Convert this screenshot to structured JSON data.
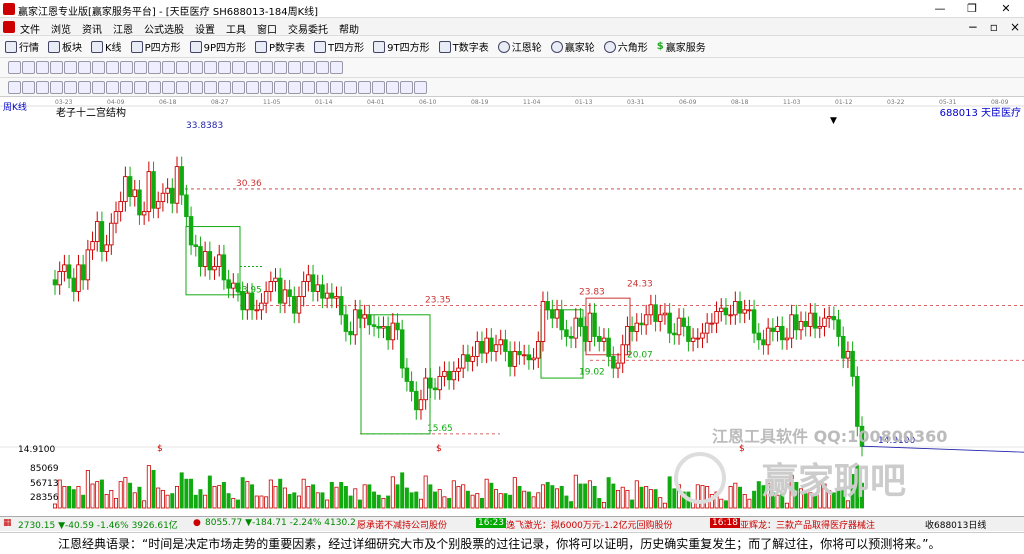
{
  "window": {
    "title": "赢家江恩专业版[赢家服务平台] - [天臣医疗  SH688013-184周K线]"
  },
  "menu": [
    "文件",
    "浏览",
    "资讯",
    "江恩",
    "公式选股",
    "设置",
    "工具",
    "窗口",
    "交易委托",
    "帮助"
  ],
  "toolbar": [
    "行情",
    "板块",
    "K线",
    "P四方形",
    "9P四方形",
    "P数字表",
    "T四方形",
    "9T四方形",
    "T数字表",
    "江恩轮",
    "赢家轮",
    "六角形",
    "赢家服务"
  ],
  "chart": {
    "period": "周K线",
    "indicator": "老子十二宫结构",
    "stock": "688013  天臣医疗",
    "date_ticks": [
      "03-23",
      "04-09",
      "06-18",
      "08-27",
      "11-05",
      "01-14",
      "04-01",
      "06-10",
      "08-19",
      "11-04",
      "01-13",
      "03-31",
      "06-09",
      "08-18",
      "11-03",
      "01-12",
      "03-22",
      "05-31",
      "08-09"
    ],
    "level_labels": [
      "33.8383",
      "30.36",
      "23.95",
      "23.35",
      "19.02",
      "15.65",
      "23.83",
      "24.33",
      "20.07",
      "14.9100"
    ],
    "price_left": "14.9100",
    "vol_labels": [
      "85069",
      "56713",
      "28356"
    ],
    "markers": [
      "$",
      "$",
      "$"
    ],
    "watermark1": "江恩工具软件  QQ:100800360",
    "watermark2": "赢家聊吧"
  },
  "chart_data": {
    "type": "candlestick",
    "x_ticks": [
      "03-23",
      "04-09",
      "06-18",
      "08-27",
      "11-05",
      "01-14",
      "04-01",
      "06-10",
      "08-19",
      "11-04",
      "01-13",
      "03-31",
      "06-09",
      "08-18",
      "11-03",
      "01-12",
      "03-22",
      "05-31",
      "08-09"
    ],
    "close": [
      24.6,
      25.4,
      25.8,
      25.0,
      24.2,
      25.8,
      24.9,
      26.7,
      27.2,
      28.4,
      26.6,
      27.0,
      28.3,
      29.0,
      29.6,
      31.1,
      29.9,
      30.3,
      28.8,
      29.0,
      31.4,
      29.2,
      29.6,
      30.1,
      30.4,
      29.5,
      31.7,
      30.0,
      28.7,
      27.0,
      26.9,
      25.7,
      26.6,
      25.5,
      25.7,
      26.4,
      24.9,
      24.4,
      24.7,
      24.2,
      23.1,
      24.1,
      23.1,
      23.1,
      23.5,
      24.2,
      24.8,
      25.0,
      23.5,
      24.3,
      23.9,
      22.9,
      23.9,
      24.8,
      25.2,
      24.2,
      24.6,
      23.8,
      24.1,
      23.8,
      23.9,
      22.8,
      21.8,
      21.6,
      23.1,
      22.6,
      22.8,
      22.2,
      22.1,
      22.0,
      22.1,
      21.3,
      22.3,
      21.9,
      19.6,
      18.8,
      18.2,
      17.1,
      17.7,
      19.0,
      18.4,
      18.3,
      19.1,
      19.4,
      18.9,
      19.4,
      19.6,
      20.4,
      20.0,
      20.3,
      21.2,
      20.5,
      21.4,
      20.6,
      21.0,
      21.3,
      20.6,
      19.7,
      20.6,
      20.4,
      20.4,
      20.1,
      20.2,
      21.2,
      23.6,
      23.1,
      22.6,
      23.1,
      21.9,
      21.5,
      21.4,
      22.6,
      22.1,
      21.2,
      22.9,
      21.5,
      21.2,
      21.4,
      20.3,
      19.6,
      19.9,
      21.0,
      22.1,
      21.8,
      22.3,
      22.2,
      22.8,
      23.4,
      22.4,
      22.8,
      22.9,
      21.7,
      21.6,
      22.6,
      22.1,
      21.2,
      21.4,
      21.4,
      21.7,
      22.3,
      22.3,
      23.0,
      23.2,
      22.8,
      22.8,
      23.6,
      22.9,
      23.1,
      23.1,
      21.7,
      21.3,
      21.0,
      22.0,
      21.8,
      22.1,
      21.3,
      21.4,
      22.8,
      21.9,
      22.4,
      22.1,
      22.9,
      22.0,
      22.1,
      22.6,
      22.7,
      22.5,
      21.5,
      20.2,
      20.6,
      19.1,
      16.1,
      14.9
    ],
    "levels": [
      33.84,
      30.36,
      23.95,
      23.35,
      23.83,
      24.33,
      20.07,
      19.02,
      15.65,
      14.91
    ],
    "boxes": [
      {
        "top": 28.1,
        "bottom": 24.0
      },
      {
        "top": 22.8,
        "bottom": 15.65
      },
      {
        "top": 23.1,
        "bottom": 19.0
      },
      {
        "top": 23.8,
        "bottom": 20.4
      }
    ],
    "volume_ticks": [
      85069,
      56713,
      28356
    ],
    "ylim": [
      14.5,
      34.5
    ]
  },
  "status": {
    "sh": "2730.15 ▼-40.59 -1.46% 3926.61亿",
    "sz": "8055.77 ▼-184.71 -2.24% 4130.2",
    "news1": "愿承诺不减持公司股份",
    "time1": "16:23",
    "news2": "逸飞激光：拟6000万元-1.2亿元回购股份",
    "time2": "16:18",
    "news3": "亚辉龙：三款产品取得医疗器械注",
    "stock": "收688013日线"
  },
  "quote": "江恩经典语录：“时间是决定市场走势的重要因素，经过详细研究大市及个别股票的过往记录，你将可以证明，历史确实重复发生；而了解过往，你将可以预测将来。”。"
}
